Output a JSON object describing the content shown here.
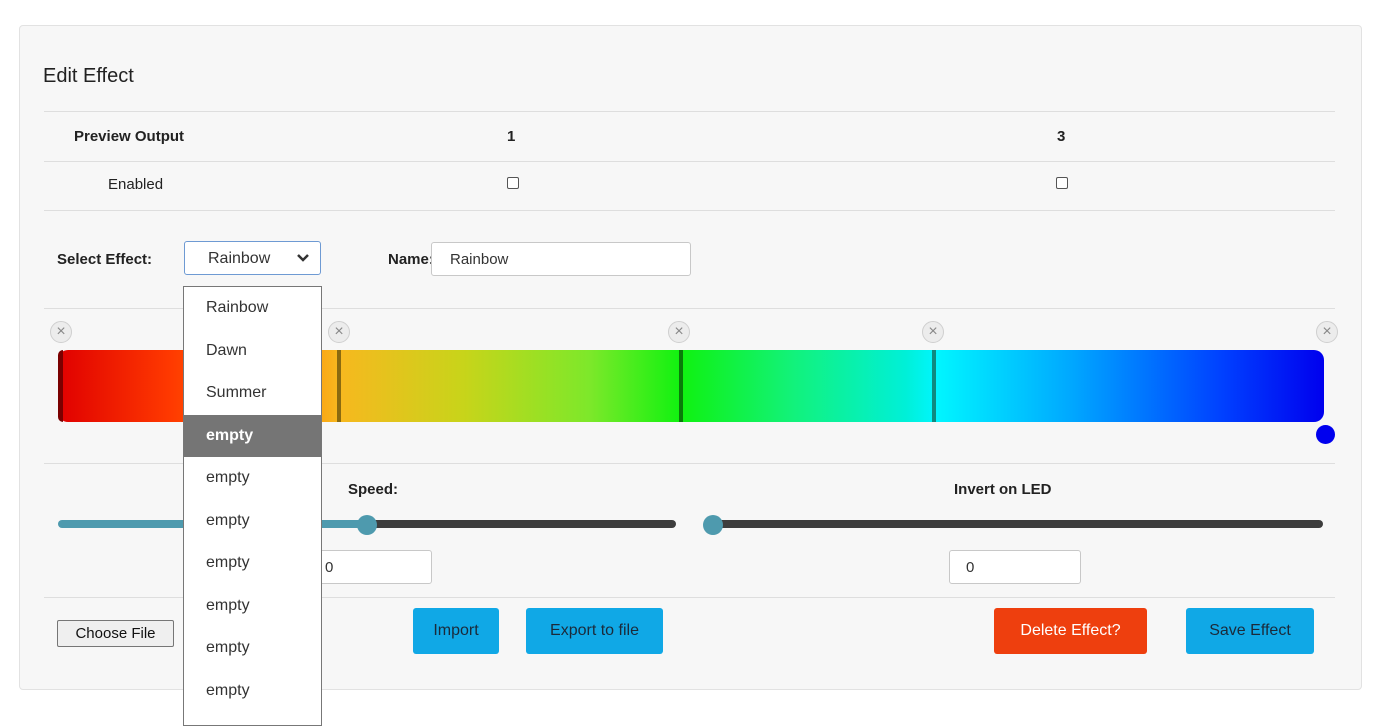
{
  "panel": {
    "title": "Edit Effect"
  },
  "preview": {
    "header_label": "Preview Output",
    "outputs": [
      "1",
      "3"
    ],
    "enabled_label": "Enabled"
  },
  "effect": {
    "select_label": "Select Effect:",
    "selected": "Rainbow",
    "name_label": "Name:",
    "name_value": "Rainbow",
    "options": [
      "Rainbow",
      "Dawn",
      "Summer",
      "empty",
      "empty",
      "empty",
      "empty",
      "empty",
      "empty",
      "empty"
    ],
    "highlighted_index": 3
  },
  "gradient": {
    "stops": [
      "#ff0000",
      "#f7b81f",
      "#10f210",
      "#00f6ff",
      "#0000ee"
    ],
    "handle_color": "#0000ee",
    "remove_icon": "×"
  },
  "controls": {
    "speed": {
      "label": "Speed:",
      "value": "0",
      "level": 0.5
    },
    "invert": {
      "label": "Invert on LED",
      "value": "0",
      "level": 0
    }
  },
  "actions": {
    "choose_file": "Choose File",
    "import": "Import",
    "export": "Export to file",
    "delete": "Delete Effect?",
    "save": "Save Effect"
  }
}
